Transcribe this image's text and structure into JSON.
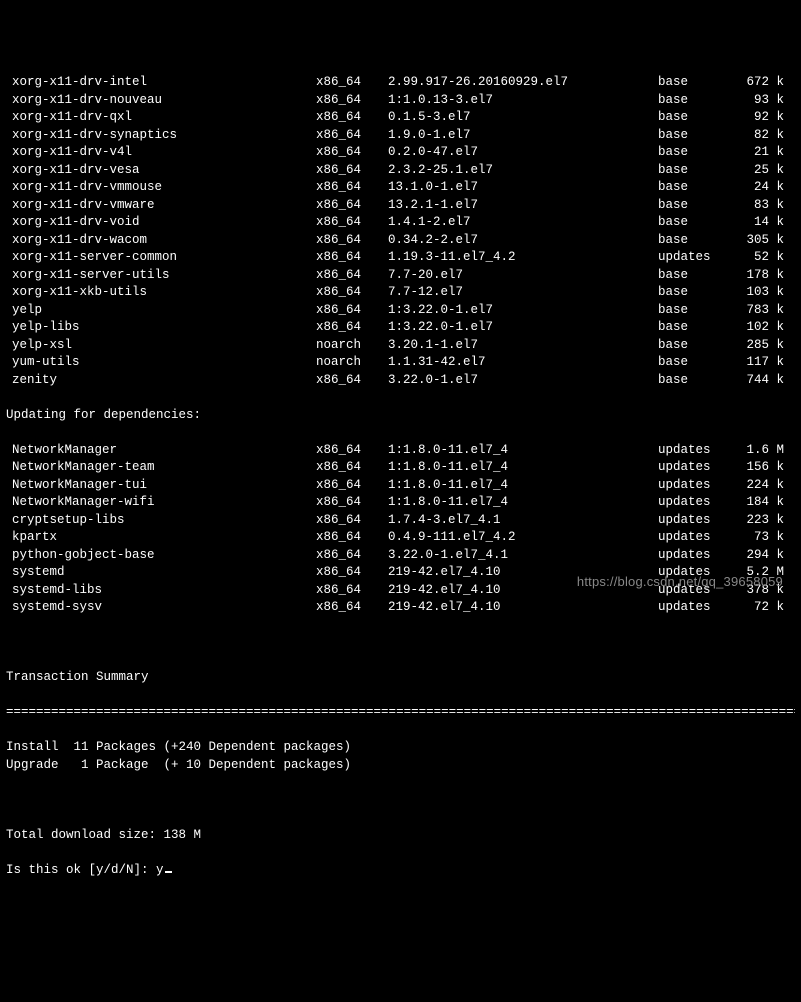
{
  "packages_install": [
    {
      "name": "xorg-x11-drv-intel",
      "arch": "x86_64",
      "ver": "2.99.917-26.20160929.el7",
      "repo": "base",
      "size": "672 k"
    },
    {
      "name": "xorg-x11-drv-nouveau",
      "arch": "x86_64",
      "ver": "1:1.0.13-3.el7",
      "repo": "base",
      "size": "93 k"
    },
    {
      "name": "xorg-x11-drv-qxl",
      "arch": "x86_64",
      "ver": "0.1.5-3.el7",
      "repo": "base",
      "size": "92 k"
    },
    {
      "name": "xorg-x11-drv-synaptics",
      "arch": "x86_64",
      "ver": "1.9.0-1.el7",
      "repo": "base",
      "size": "82 k"
    },
    {
      "name": "xorg-x11-drv-v4l",
      "arch": "x86_64",
      "ver": "0.2.0-47.el7",
      "repo": "base",
      "size": "21 k"
    },
    {
      "name": "xorg-x11-drv-vesa",
      "arch": "x86_64",
      "ver": "2.3.2-25.1.el7",
      "repo": "base",
      "size": "25 k"
    },
    {
      "name": "xorg-x11-drv-vmmouse",
      "arch": "x86_64",
      "ver": "13.1.0-1.el7",
      "repo": "base",
      "size": "24 k"
    },
    {
      "name": "xorg-x11-drv-vmware",
      "arch": "x86_64",
      "ver": "13.2.1-1.el7",
      "repo": "base",
      "size": "83 k"
    },
    {
      "name": "xorg-x11-drv-void",
      "arch": "x86_64",
      "ver": "1.4.1-2.el7",
      "repo": "base",
      "size": "14 k"
    },
    {
      "name": "xorg-x11-drv-wacom",
      "arch": "x86_64",
      "ver": "0.34.2-2.el7",
      "repo": "base",
      "size": "305 k"
    },
    {
      "name": "xorg-x11-server-common",
      "arch": "x86_64",
      "ver": "1.19.3-11.el7_4.2",
      "repo": "updates",
      "size": "52 k"
    },
    {
      "name": "xorg-x11-server-utils",
      "arch": "x86_64",
      "ver": "7.7-20.el7",
      "repo": "base",
      "size": "178 k"
    },
    {
      "name": "xorg-x11-xkb-utils",
      "arch": "x86_64",
      "ver": "7.7-12.el7",
      "repo": "base",
      "size": "103 k"
    },
    {
      "name": "yelp",
      "arch": "x86_64",
      "ver": "1:3.22.0-1.el7",
      "repo": "base",
      "size": "783 k"
    },
    {
      "name": "yelp-libs",
      "arch": "x86_64",
      "ver": "1:3.22.0-1.el7",
      "repo": "base",
      "size": "102 k"
    },
    {
      "name": "yelp-xsl",
      "arch": "noarch",
      "ver": "3.20.1-1.el7",
      "repo": "base",
      "size": "285 k"
    },
    {
      "name": "yum-utils",
      "arch": "noarch",
      "ver": "1.1.31-42.el7",
      "repo": "base",
      "size": "117 k"
    },
    {
      "name": "zenity",
      "arch": "x86_64",
      "ver": "3.22.0-1.el7",
      "repo": "base",
      "size": "744 k"
    }
  ],
  "deps_header": "Updating for dependencies:",
  "packages_deps": [
    {
      "name": "NetworkManager",
      "arch": "x86_64",
      "ver": "1:1.8.0-11.el7_4",
      "repo": "updates",
      "size": "1.6 M"
    },
    {
      "name": "NetworkManager-team",
      "arch": "x86_64",
      "ver": "1:1.8.0-11.el7_4",
      "repo": "updates",
      "size": "156 k"
    },
    {
      "name": "NetworkManager-tui",
      "arch": "x86_64",
      "ver": "1:1.8.0-11.el7_4",
      "repo": "updates",
      "size": "224 k"
    },
    {
      "name": "NetworkManager-wifi",
      "arch": "x86_64",
      "ver": "1:1.8.0-11.el7_4",
      "repo": "updates",
      "size": "184 k"
    },
    {
      "name": "cryptsetup-libs",
      "arch": "x86_64",
      "ver": "1.7.4-3.el7_4.1",
      "repo": "updates",
      "size": "223 k"
    },
    {
      "name": "kpartx",
      "arch": "x86_64",
      "ver": "0.4.9-111.el7_4.2",
      "repo": "updates",
      "size": "73 k"
    },
    {
      "name": "python-gobject-base",
      "arch": "x86_64",
      "ver": "3.22.0-1.el7_4.1",
      "repo": "updates",
      "size": "294 k"
    },
    {
      "name": "systemd",
      "arch": "x86_64",
      "ver": "219-42.el7_4.10",
      "repo": "updates",
      "size": "5.2 M"
    },
    {
      "name": "systemd-libs",
      "arch": "x86_64",
      "ver": "219-42.el7_4.10",
      "repo": "updates",
      "size": "378 k"
    },
    {
      "name": "systemd-sysv",
      "arch": "x86_64",
      "ver": "219-42.el7_4.10",
      "repo": "updates",
      "size": "72 k"
    }
  ],
  "summary_header": "Transaction Summary",
  "rule": "================================================================================================================",
  "summary_lines": [
    "Install  11 Packages (+240 Dependent packages)",
    "Upgrade   1 Package  (+ 10 Dependent packages)"
  ],
  "total_line": "Total download size: 138 M",
  "prompt": "Is this ok [y/d/N]: ",
  "answer": "y",
  "watermark": "https://blog.csdn.net/qq_39658059"
}
